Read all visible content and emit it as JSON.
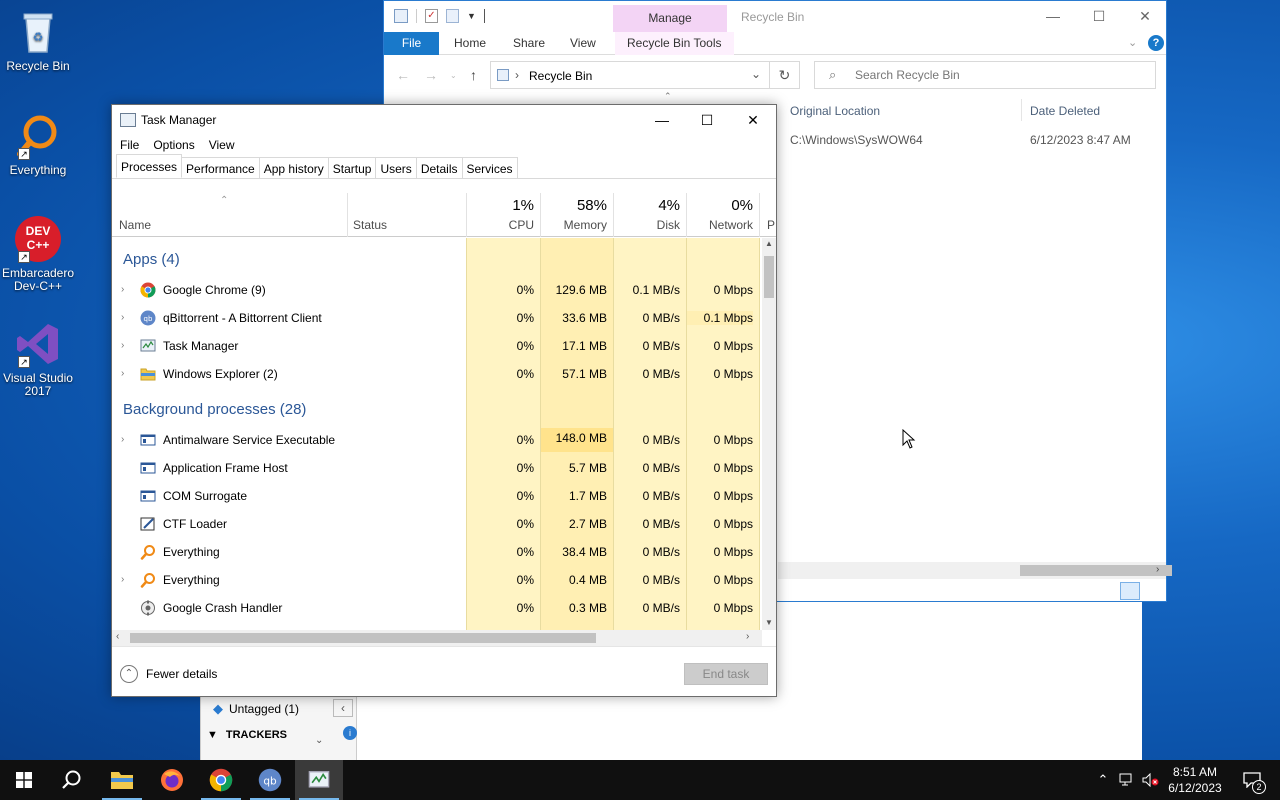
{
  "desktop": {
    "icons": [
      {
        "label": "Recycle Bin"
      },
      {
        "label": "Everything"
      },
      {
        "label": "Embarcadero Dev-C++",
        "badge": "DEV C++"
      },
      {
        "label": "Visual Studio 2017"
      }
    ]
  },
  "explorer": {
    "title": "Recycle Bin",
    "manage_tab": "Manage",
    "ribbon": {
      "file": "File",
      "home": "Home",
      "share": "Share",
      "view": "View",
      "tools": "Recycle Bin Tools"
    },
    "address": "Recycle Bin",
    "search_placeholder": "Search Recycle Bin",
    "columns": {
      "original_location": "Original Location",
      "date_deleted": "Date Deleted"
    },
    "item": {
      "original_location": "C:\\Windows\\SysWOW64",
      "date_deleted": "6/12/2023 8:47 AM"
    }
  },
  "qbittorrent": {
    "untagged": "Untagged (1)",
    "trackers": "TRACKERS"
  },
  "taskmanager": {
    "title": "Task Manager",
    "menu": {
      "file": "File",
      "options": "Options",
      "view": "View"
    },
    "tabs": [
      "Processes",
      "Performance",
      "App history",
      "Startup",
      "Users",
      "Details",
      "Services"
    ],
    "headers": {
      "name": "Name",
      "status": "Status",
      "cpu_pct": "1%",
      "cpu": "CPU",
      "mem_pct": "58%",
      "memory": "Memory",
      "disk_pct": "4%",
      "disk": "Disk",
      "net_pct": "0%",
      "network": "Network",
      "power": "P"
    },
    "apps_group": "Apps (4)",
    "apps": [
      {
        "name": "Google Chrome (9)",
        "cpu": "0%",
        "memory": "129.6 MB",
        "disk": "0.1 MB/s",
        "network": "0 Mbps",
        "icon": "chrome-icon"
      },
      {
        "name": "qBittorrent - A Bittorrent Client",
        "cpu": "0%",
        "memory": "33.6 MB",
        "disk": "0 MB/s",
        "network": "0.1 Mbps",
        "icon": "qbittorrent-icon"
      },
      {
        "name": "Task Manager",
        "cpu": "0%",
        "memory": "17.1 MB",
        "disk": "0 MB/s",
        "network": "0 Mbps",
        "icon": "task-manager-icon"
      },
      {
        "name": "Windows Explorer (2)",
        "cpu": "0%",
        "memory": "57.1 MB",
        "disk": "0 MB/s",
        "network": "0 Mbps",
        "icon": "folder-icon"
      }
    ],
    "bg_group": "Background processes (28)",
    "background": [
      {
        "name": "Antimalware Service Executable",
        "cpu": "0%",
        "memory": "148.0 MB",
        "disk": "0 MB/s",
        "network": "0 Mbps",
        "icon": "service-window-icon"
      },
      {
        "name": "Application Frame Host",
        "cpu": "0%",
        "memory": "5.7 MB",
        "disk": "0 MB/s",
        "network": "0 Mbps",
        "icon": "service-window-icon"
      },
      {
        "name": "COM Surrogate",
        "cpu": "0%",
        "memory": "1.7 MB",
        "disk": "0 MB/s",
        "network": "0 Mbps",
        "icon": "service-window-icon"
      },
      {
        "name": "CTF Loader",
        "cpu": "0%",
        "memory": "2.7 MB",
        "disk": "0 MB/s",
        "network": "0 Mbps",
        "icon": "ctf-loader-icon"
      },
      {
        "name": "Everything",
        "cpu": "0%",
        "memory": "38.4 MB",
        "disk": "0 MB/s",
        "network": "0 Mbps",
        "icon": "everything-icon"
      },
      {
        "name": "Everything",
        "cpu": "0%",
        "memory": "0.4 MB",
        "disk": "0 MB/s",
        "network": "0 Mbps",
        "icon": "everything-icon"
      },
      {
        "name": "Google Crash Handler",
        "cpu": "0%",
        "memory": "0.3 MB",
        "disk": "0 MB/s",
        "network": "0 Mbps",
        "icon": "crash-handler-icon"
      }
    ],
    "fewer_details": "Fewer details",
    "end_task": "End task"
  },
  "taskbar": {
    "time": "8:51 AM",
    "date": "6/12/2023",
    "notifications": "2",
    "apps": [
      "start-icon",
      "search-icon",
      "file-explorer-icon",
      "firefox-icon",
      "chrome-icon",
      "qbittorrent-icon",
      "task-manager-icon"
    ]
  }
}
